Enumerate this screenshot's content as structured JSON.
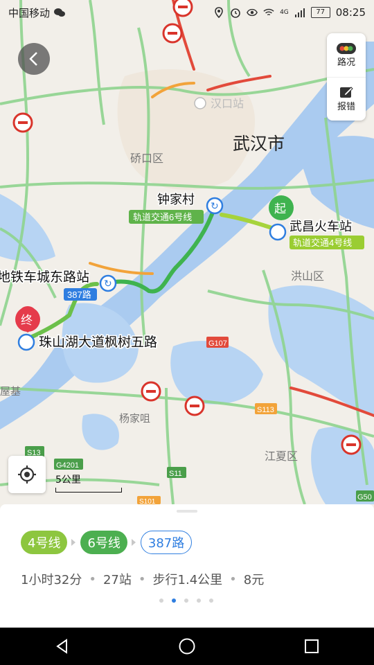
{
  "status_bar": {
    "carrier": "中国移动",
    "signal_type": "4G",
    "battery": "77",
    "time": "08:25"
  },
  "toolbar": {
    "traffic_label": "路况",
    "report_label": "报错"
  },
  "map": {
    "labels": {
      "hankou_station": "汉口站",
      "wuhan_city": "武汉市",
      "qiaokou": "硚口区",
      "zhongjiacun": "钟家村",
      "line6_tag": "轨道交通6号线",
      "start_marker": "起",
      "wuchang_station": "武昌火车站",
      "line4_tag": "轨道交通4号线",
      "hongshan": "洪山区",
      "checheng_station": "地铁车城东路站",
      "bus_tag": "387路",
      "end_marker": "终",
      "zhushanhu": "珠山湖大道枫树五路",
      "g107": "G107",
      "wuji": "屋基",
      "yangjiaju": "杨家咀",
      "s113": "S113",
      "jiangxia": "江夏区",
      "s13": "S13",
      "g4201": "G4201",
      "s11": "S11",
      "s101": "S101",
      "g50": "G50"
    },
    "scale_label": "5公里"
  },
  "route": {
    "chips": [
      {
        "label": "4号线",
        "type": "metro",
        "color": "#8dc63f"
      },
      {
        "label": "6号线",
        "type": "metro",
        "color": "#4caf50"
      },
      {
        "label": "387路",
        "type": "bus",
        "color": "#2f7ee0"
      }
    ],
    "duration": "1小时32分",
    "stops": "27站",
    "walk": "步行1.4公里",
    "fare": "8元",
    "page_total": 5,
    "page_active": 2
  }
}
